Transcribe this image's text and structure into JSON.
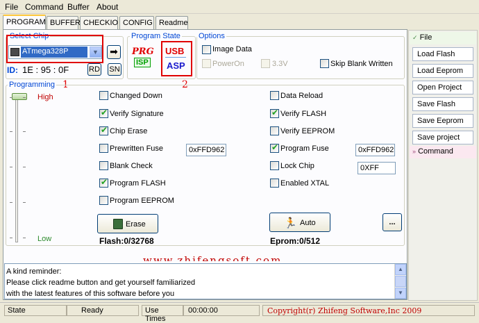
{
  "menu": [
    "File",
    "Command",
    "Buffer",
    "About"
  ],
  "tabs": [
    "PROGRAM",
    "BUFFER",
    "CHECKIO",
    "CONFIG",
    "Readme"
  ],
  "select_chip": {
    "legend": "Select Chip",
    "value": "ATmega328P",
    "id_label": "ID:",
    "id_value": "1E : 95 : 0F",
    "rd_button": "RD",
    "sn_button": "SN",
    "annotation": "1"
  },
  "program_state": {
    "legend": "Program State",
    "prg_text": "PRG",
    "isp_text": "ISP",
    "usb_text": "USB",
    "asp_text": "ASP",
    "annotation": "2"
  },
  "options": {
    "legend": "Options",
    "image_data": "Image Data",
    "power_on": "PowerOn",
    "v33": "3.3V",
    "skip_blank": "Skip Blank Written"
  },
  "programming": {
    "legend": "Programming",
    "high_label": "High",
    "low_label": "Low",
    "left_checks": [
      {
        "label": "Changed Down",
        "checked": false
      },
      {
        "label": "Verify Signature",
        "checked": true
      },
      {
        "label": "Chip Erase",
        "checked": true
      },
      {
        "label": "Prewritten Fuse",
        "checked": false
      },
      {
        "label": "Blank Check",
        "checked": false
      },
      {
        "label": "Program FLASH",
        "checked": true
      },
      {
        "label": "Program EEPROM",
        "checked": false
      }
    ],
    "right_checks": [
      {
        "label": "Data Reload",
        "checked": false
      },
      {
        "label": "Verify FLASH",
        "checked": true
      },
      {
        "label": "Verify EEPROM",
        "checked": false
      },
      {
        "label": "Program Fuse",
        "checked": true
      },
      {
        "label": "Lock Chip",
        "checked": false
      },
      {
        "label": "Enabled XTAL",
        "checked": false
      }
    ],
    "prewritten_fuse_value": "0xFFD962",
    "program_fuse_value": "0xFFD962",
    "lock_chip_value": "0XFF",
    "erase_button": "Erase",
    "auto_button": "Auto",
    "more_button": "...",
    "flash_status": "Flash:0/32768",
    "eprom_status": "Eprom:0/512"
  },
  "watermark": "www.zhifengsoft.com",
  "reminder": [
    "A kind reminder:",
    "Please click readme button and get yourself familiarized",
    "with the latest features of this software before you"
  ],
  "sidebar": {
    "file_header": "File",
    "file_items": [
      "Load Flash",
      "Load Eeprom",
      "Open Project",
      "Save Flash",
      "Save Eeprom",
      "Save project"
    ],
    "command_header": "Command"
  },
  "status": {
    "state_label": "State",
    "state_value": "Ready",
    "use_times_label": "Use Times",
    "use_times_value": "00:00:00",
    "copyright": "Copyright(r) Zhifeng Software,Inc 2009"
  },
  "colors": {
    "accent_red": "#e00000",
    "legend_blue": "#0046d5",
    "status_red": "#c00000"
  }
}
